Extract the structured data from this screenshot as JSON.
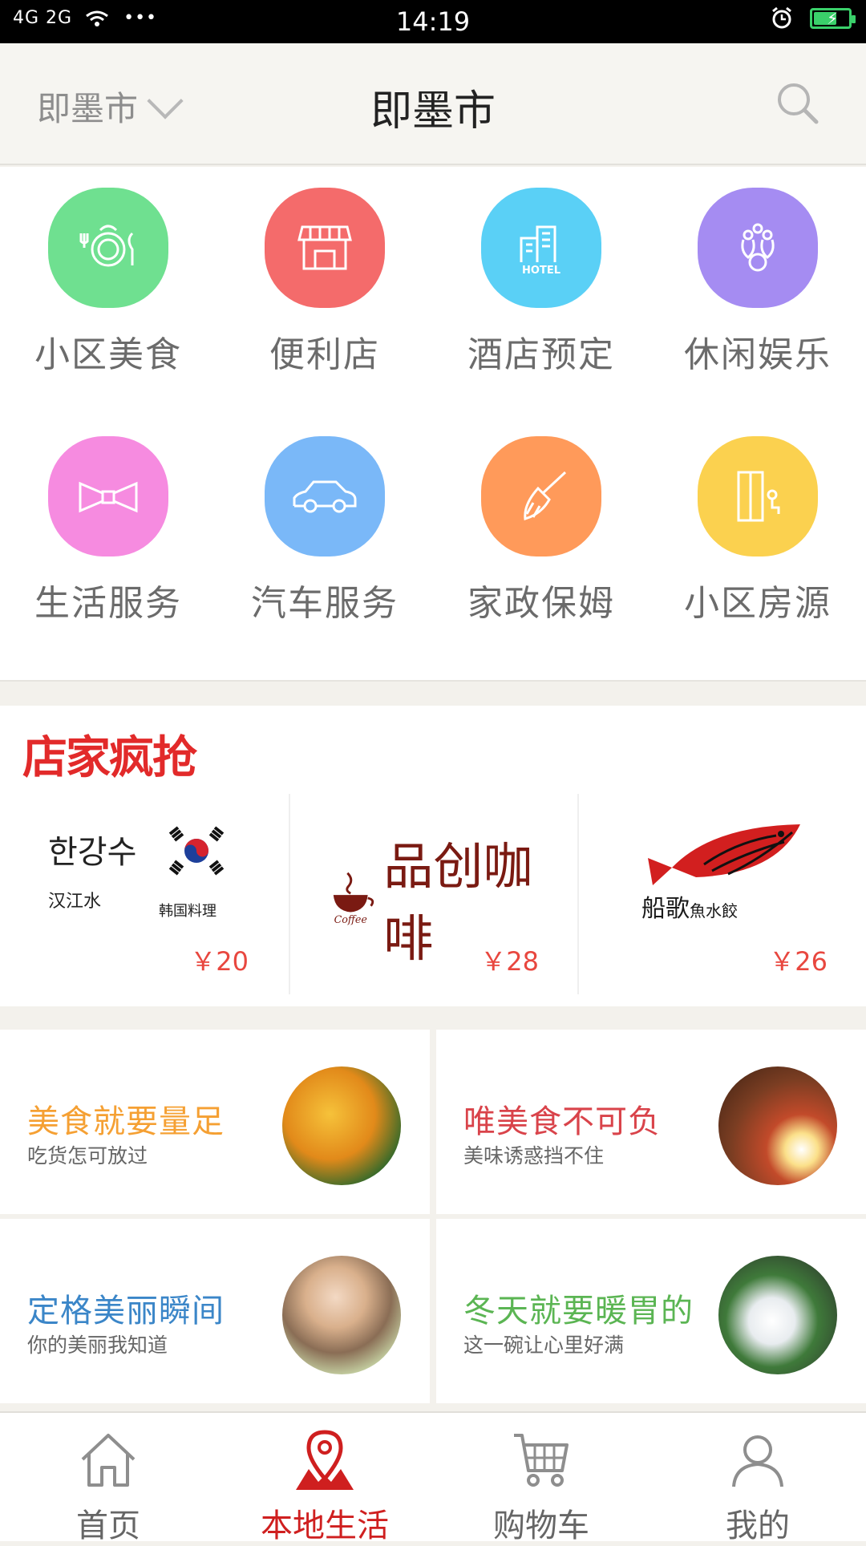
{
  "status_bar": {
    "signal_text": "4G 2G",
    "dots": "•••",
    "time": "14:19"
  },
  "header": {
    "city_select": "即墨市",
    "title": "即墨市"
  },
  "categories": [
    {
      "label": "小区美食",
      "icon": "dining-icon",
      "color": "#6fe090"
    },
    {
      "label": "便利店",
      "icon": "store-icon",
      "color": "#f46b6b"
    },
    {
      "label": "酒店预定",
      "icon": "hotel-icon",
      "color": "#5ad0f6"
    },
    {
      "label": "休闲娱乐",
      "icon": "bowling-icon",
      "color": "#a58cf2"
    },
    {
      "label": "生活服务",
      "icon": "bow-tie-icon",
      "color": "#f68be0"
    },
    {
      "label": "汽车服务",
      "icon": "car-icon",
      "color": "#7ab8f8"
    },
    {
      "label": "家政保姆",
      "icon": "broom-icon",
      "color": "#ff9a5a"
    },
    {
      "label": "小区房源",
      "icon": "door-icon",
      "color": "#fbd14f"
    }
  ],
  "deals": {
    "title": "店家疯抢",
    "items": [
      {
        "logo_line1": "한강수",
        "logo_line2": "汉江水",
        "logo_line3": "韩国料理",
        "price": "￥20"
      },
      {
        "logo_text": "品创咖啡",
        "logo_sub": "Coffee",
        "price": "￥28"
      },
      {
        "logo_text": "船歌",
        "logo_sub": "魚水餃",
        "price": "￥26"
      }
    ]
  },
  "promos": [
    {
      "title": "美食就要量足",
      "subtitle": "吃货怎可放过",
      "color": "#f5a033"
    },
    {
      "title": "唯美食不可负",
      "subtitle": "美味诱惑挡不住",
      "color": "#d9434a"
    },
    {
      "title": "定格美丽瞬间",
      "subtitle": "你的美丽我知道",
      "color": "#3b86c8"
    },
    {
      "title": "冬天就要暖胃的",
      "subtitle": "这一碗让心里好满",
      "color": "#5bb553"
    }
  ],
  "tabs": [
    {
      "label": "首页",
      "icon": "home-icon"
    },
    {
      "label": "本地生活",
      "icon": "location-pin-icon",
      "active": true
    },
    {
      "label": "购物车",
      "icon": "cart-icon"
    },
    {
      "label": "我的",
      "icon": "user-icon"
    }
  ]
}
